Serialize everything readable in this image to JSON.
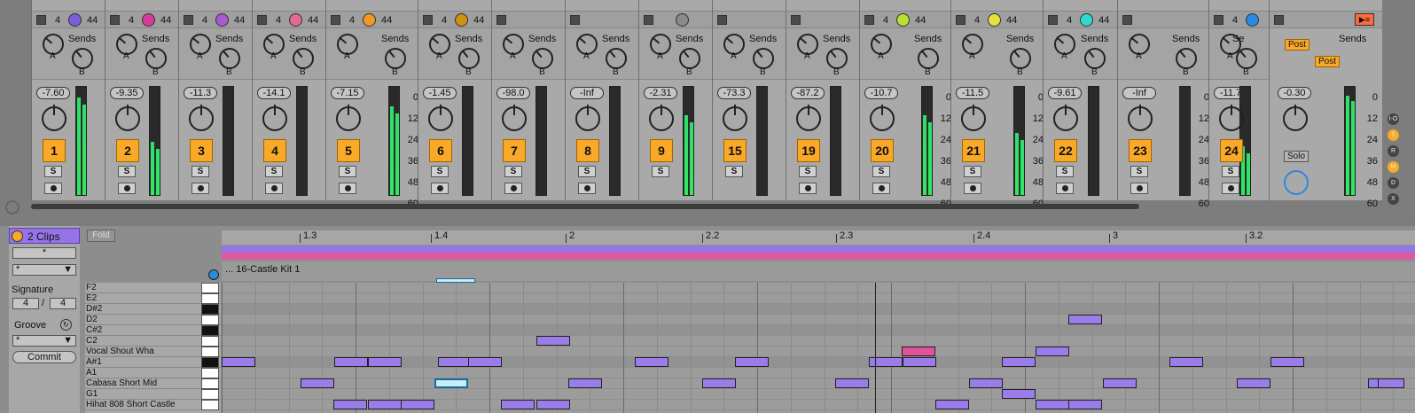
{
  "tracks": [
    {
      "num": "1",
      "vol": "-7.60",
      "sends": "Sends",
      "io_a": "4",
      "io_b": "44",
      "dot": "#7b5fd8"
    },
    {
      "num": "2",
      "vol": "-9.35",
      "sends": "Sends",
      "io_a": "4",
      "io_b": "44",
      "dot": "#d83a9a"
    },
    {
      "num": "3",
      "vol": "-11.3",
      "sends": "Sends",
      "io_a": "4",
      "io_b": "44",
      "dot": "#a85ad0"
    },
    {
      "num": "4",
      "vol": "-14.1",
      "sends": "Sends",
      "io_a": "4",
      "io_b": "44",
      "dot": "#e06a90"
    },
    {
      "num": "5",
      "vol": "-7.15",
      "sends": "Sends",
      "io_a": "4",
      "io_b": "44",
      "dot": "#f09a22"
    },
    {
      "num": "6",
      "vol": "-1.45",
      "sends": "Sends",
      "io_a": "4",
      "io_b": "44",
      "dot": "#d09010"
    },
    {
      "num": "7",
      "vol": "-98.0",
      "sends": "Sends",
      "io_a": "",
      "io_b": "",
      "dot": ""
    },
    {
      "num": "8",
      "vol": "-Inf",
      "sends": "Sends",
      "io_a": "",
      "io_b": "",
      "dot": ""
    },
    {
      "num": "9",
      "vol": "-2.31",
      "sends": "Sends",
      "io_a": "",
      "io_b": "",
      "dot": "#8a8a8a"
    },
    {
      "num": "15",
      "vol": "-73.3",
      "sends": "Sends",
      "io_a": "",
      "io_b": "",
      "dot": ""
    },
    {
      "num": "19",
      "vol": "-87.2",
      "sends": "Sends",
      "io_a": "",
      "io_b": "",
      "dot": ""
    },
    {
      "num": "20",
      "vol": "-10.7",
      "sends": "Sends",
      "io_a": "4",
      "io_b": "44",
      "dot": "#b8e030"
    },
    {
      "num": "21",
      "vol": "-11.5",
      "sends": "Sends",
      "io_a": "4",
      "io_b": "44",
      "dot": "#e8e040"
    },
    {
      "num": "22",
      "vol": "-9.61",
      "sends": "Sends",
      "io_a": "4",
      "io_b": "44",
      "dot": "#30d8d0"
    },
    {
      "num": "23",
      "vol": "-Inf",
      "sends": "Sends",
      "io_a": "",
      "io_b": "",
      "dot": ""
    },
    {
      "num": "24",
      "vol": "-11.7",
      "sends": "Se",
      "io_a": "4",
      "io_b": "",
      "dot": "#2a8ae0"
    }
  ],
  "master": {
    "vol": "-0.30",
    "sends": "Sends",
    "post1": "Post",
    "post2": "Post",
    "solo": "Solo"
  },
  "knob_labels": {
    "a": "A",
    "b": "B"
  },
  "solo_label": "S",
  "scale": [
    "0",
    "12",
    "24",
    "36",
    "48",
    "60"
  ],
  "side_buttons": [
    "I-O",
    "S",
    "R",
    "M",
    "D",
    "X"
  ],
  "clip": {
    "title": "2 Clips",
    "field1": "*",
    "select1": "*",
    "signature_label": "Signature",
    "sig_num": "4",
    "sig_sep": "/",
    "sig_den": "4",
    "groove_label": "Groove",
    "groove_select": "*",
    "commit": "Commit",
    "fold": "Fold"
  },
  "ruler": [
    "1.3",
    "1.4",
    "2",
    "2.2",
    "2.3",
    "2.4",
    "3",
    "3.2"
  ],
  "clip_title": "... 16-Castle Kit 1",
  "keys": [
    "F2",
    "E2",
    "D#2",
    "D2",
    "C#2",
    "C2",
    "Vocal Shout Wha",
    "A#1",
    "A1",
    "Cabasa Short Mid",
    "G1",
    "Hihat 808 Short Castle"
  ]
}
